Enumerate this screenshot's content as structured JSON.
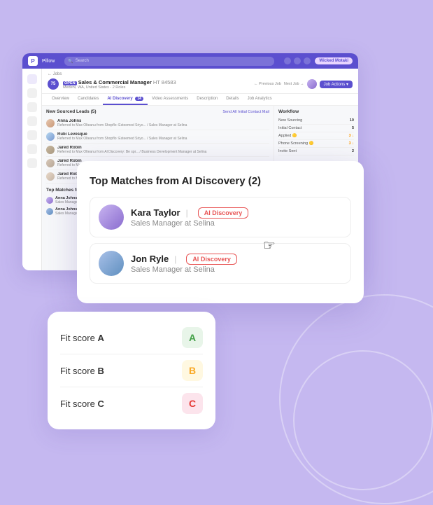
{
  "app": {
    "logo": "P",
    "nav_title": "Pillow",
    "search_placeholder": "Search",
    "user_label": "Wicked Motaki",
    "prev_btn": "← Previous Job",
    "next_btn": "Next Job →",
    "job_score": "75",
    "job_id": "HT 84583",
    "job_title": "Sales & Commercial Manager",
    "job_location": "Medeni, WA, United States - 2 Roles",
    "job_action": "Job Actions ▾",
    "tabs": [
      {
        "label": "Overview",
        "active": false
      },
      {
        "label": "Candidates",
        "active": false
      },
      {
        "label": "AI Discovery",
        "active": true,
        "badge": "14"
      },
      {
        "label": "Video Assessments",
        "active": false
      },
      {
        "label": "Description",
        "active": false
      },
      {
        "label": "Details",
        "active": false
      },
      {
        "label": "Job Analytics",
        "active": false
      }
    ],
    "left_section_title": "New Sourced Leads (5)",
    "left_section_action": "Send All Initial Contact Mail",
    "leads": [
      {
        "name": "Anna Johns",
        "detail": "Referred to Max Olteanu from Shopflo: Esteemed Sriyo... / Sales Manager at Selina"
      },
      {
        "name": "Rubi Levesque",
        "detail": "Referred to Max Olteanu from Shopflo: Esteemed Sriyo... / Sales Manager at Selina"
      },
      {
        "name": "Jared Robin",
        "detail": "Referred to Max Olteanu from Al Discovery: Be spr... / Business Development Manager at Selina"
      },
      {
        "name": "Jared Robin",
        "detail": "Referred to Max Olteanu from Al Discovery: Be spr... / Business Developer at Selina"
      },
      {
        "name": "Jared Robin",
        "detail": "Referred to Max Olteanu from Al Discovery: Be spr... / Business Developer at Selina"
      }
    ],
    "top_matches_mini_title": "Top Matches from",
    "top_matches_mini": [
      {
        "name": "Anna Johns",
        "role": "Sales Manager at Selina"
      },
      {
        "name": "Anna Johns",
        "role": "Sales Manager at Selina"
      }
    ],
    "workflow_title": "Workflow",
    "workflow_rows": [
      {
        "label": "New Sourcing",
        "count": "10"
      },
      {
        "label": "Initial Contact",
        "count": "5"
      },
      {
        "label": "Applied 🟡",
        "count": "3",
        "sub": "↓"
      },
      {
        "label": "Phone Screening 🟡",
        "count": "3",
        "sub": "↓"
      },
      {
        "label": "Invite Sent",
        "count": "2"
      }
    ]
  },
  "modal": {
    "title": "Top Matches from AI Discovery (2)",
    "match1": {
      "name": "Kara Taylor",
      "role": "Sales Manager at Selina",
      "badge": "AI Discovery"
    },
    "match2": {
      "name": "Jon Ryle",
      "role": "Sales Manager at Selina",
      "badge": "AI Discovery"
    }
  },
  "fit_score_card": {
    "rows": [
      {
        "label": "Fit score",
        "grade_letter": "A",
        "grade_class": "a"
      },
      {
        "label": "Fit score",
        "grade_letter": "B",
        "grade_class": "b"
      },
      {
        "label": "Fit score",
        "grade_letter": "C",
        "grade_class": "c"
      }
    ]
  },
  "icons": {
    "search": "🔍",
    "cursor": "☞"
  }
}
